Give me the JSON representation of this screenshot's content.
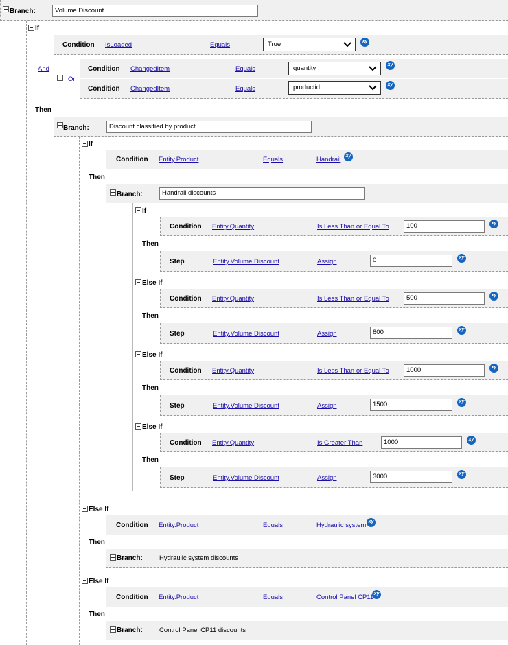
{
  "labels": {
    "branch": "Branch:",
    "if": "If",
    "else_if": "Else If",
    "then": "Then",
    "condition": "Condition",
    "step": "Step",
    "and": "And",
    "or": "Or"
  },
  "icons": {
    "xy": "xy"
  },
  "root": {
    "branch_value": "Volume Discount"
  },
  "root_if": {
    "cond1": {
      "field": "IsLoaded",
      "operator": "Equals",
      "value": "True"
    },
    "or_conds": [
      {
        "field": "ChangedItem",
        "operator": "Equals",
        "value": "quantity"
      },
      {
        "field": "ChangedItem",
        "operator": "Equals",
        "value": "productid"
      }
    ]
  },
  "branch2": {
    "value": "Discount classified by product"
  },
  "if_product": {
    "field": "Entity.Product",
    "operator": "Equals",
    "value": "Handrail"
  },
  "branch3": {
    "value": "Handrail discounts"
  },
  "rules": [
    {
      "kind": "If",
      "field": "Entity.Quantity",
      "operator": "Is Less Than or Equal To",
      "value": "100",
      "step_field": "Entity.Volume Discount",
      "step_op": "Assign",
      "step_value": "0"
    },
    {
      "kind": "Else If",
      "field": "Entity.Quantity",
      "operator": "Is Less Than or Equal To",
      "value": "500",
      "step_field": "Entity.Volume Discount",
      "step_op": "Assign",
      "step_value": "800"
    },
    {
      "kind": "Else If",
      "field": "Entity.Quantity",
      "operator": "Is Less Than or Equal To",
      "value": "1000",
      "step_field": "Entity.Volume Discount",
      "step_op": "Assign",
      "step_value": "1500"
    },
    {
      "kind": "Else If",
      "field": "Entity.Quantity",
      "operator": "Is Greater Than",
      "value": "1000",
      "step_field": "Entity.Volume Discount",
      "step_op": "Assign",
      "step_value": "3000"
    }
  ],
  "elseif_hydraulic": {
    "field": "Entity.Product",
    "operator": "Equals",
    "value": "Hydraulic system",
    "branch": "Hydraulic system discounts"
  },
  "elseif_cp11": {
    "field": "Entity.Product",
    "operator": "Equals",
    "value": "Control Panel CP11",
    "branch": "Control Panel CP11 discounts"
  }
}
